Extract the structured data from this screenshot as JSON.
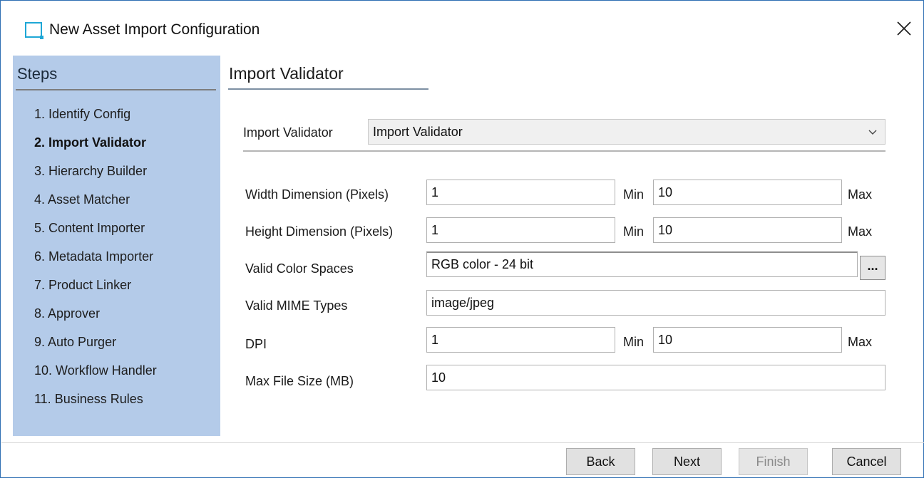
{
  "window": {
    "title": "New Asset Import Configuration",
    "app_icon": "window-icon",
    "close_icon": "close-icon"
  },
  "steps": {
    "heading": "Steps",
    "items": [
      {
        "label": "1. Identify Config",
        "active": false
      },
      {
        "label": "2. Import Validator",
        "active": true
      },
      {
        "label": "3. Hierarchy Builder",
        "active": false
      },
      {
        "label": "4. Asset Matcher",
        "active": false
      },
      {
        "label": "5. Content Importer",
        "active": false
      },
      {
        "label": "6. Metadata Importer",
        "active": false
      },
      {
        "label": "7. Product Linker",
        "active": false
      },
      {
        "label": "8. Approver",
        "active": false
      },
      {
        "label": "9. Auto Purger",
        "active": false
      },
      {
        "label": "10. Workflow Handler",
        "active": false
      },
      {
        "label": "11. Business Rules",
        "active": false
      }
    ]
  },
  "main": {
    "title": "Import Validator",
    "validator_select": {
      "label": "Import Validator",
      "value": "Import Validator"
    },
    "width": {
      "label": "Width Dimension (Pixels)",
      "min": "1",
      "min_label": "Min",
      "max": "10",
      "max_label": "Max"
    },
    "height": {
      "label": "Height Dimension (Pixels)",
      "min": "1",
      "min_label": "Min",
      "max": "10",
      "max_label": "Max"
    },
    "color_spaces": {
      "label": "Valid Color Spaces",
      "value": "RGB color - 24 bit",
      "button": "..."
    },
    "mime_types": {
      "label": "Valid MIME Types",
      "value": "image/jpeg"
    },
    "dpi": {
      "label": "DPI",
      "min": "1",
      "min_label": "Min",
      "max": "10",
      "max_label": "Max"
    },
    "max_file_size": {
      "label": "Max File Size (MB)",
      "value": "10"
    }
  },
  "footer": {
    "back": "Back",
    "next": "Next",
    "finish": "Finish",
    "cancel": "Cancel"
  },
  "colors": {
    "steps_panel_bg": "#b4cbe9",
    "window_border": "#2f6fb3",
    "icon_accent": "#1ea7d6"
  }
}
